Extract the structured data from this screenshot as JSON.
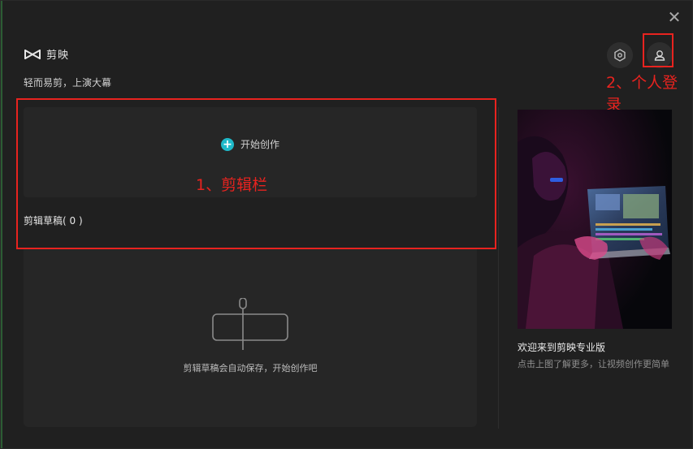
{
  "window": {
    "close_glyph": "✕"
  },
  "brand": {
    "name": "剪映",
    "slogan": "轻而易剪，上演大幕",
    "logo_icon": "capcut-logo-icon"
  },
  "header": {
    "settings_icon": "settings-hex-icon",
    "user_icon": "user-avatar-icon"
  },
  "create": {
    "label": "开始创作",
    "plus_glyph": "+"
  },
  "drafts": {
    "title": "剪辑草稿( 0 )",
    "empty_text": "剪辑草稿会自动保存，开始创作吧"
  },
  "promo": {
    "title": "欢迎来到剪映专业版",
    "description": "点击上图了解更多，让视频创作更简单"
  },
  "annotations": {
    "edit_bar": "1、剪辑栏",
    "user_login": "2、个人登录",
    "color": "#e8231f"
  },
  "colors": {
    "accent": "#1fb9c9",
    "background": "#202020",
    "card": "#262626"
  }
}
